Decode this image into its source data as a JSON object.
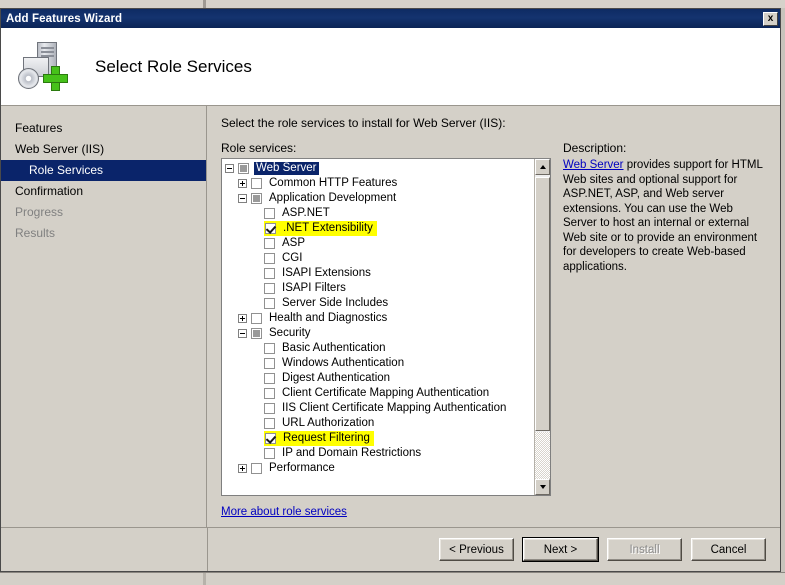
{
  "window": {
    "title": "Add Features Wizard",
    "close_label": "x",
    "header_title": "Select Role Services",
    "header_icon": "server-add-icon"
  },
  "sidebar": {
    "items": [
      {
        "label": "Features",
        "state": "normal",
        "indented": false
      },
      {
        "label": "Web Server (IIS)",
        "state": "normal",
        "indented": false
      },
      {
        "label": "Role Services",
        "state": "selected",
        "indented": true
      },
      {
        "label": "Confirmation",
        "state": "normal",
        "indented": false
      },
      {
        "label": "Progress",
        "state": "disabled",
        "indented": false
      },
      {
        "label": "Results",
        "state": "disabled",
        "indented": false
      }
    ]
  },
  "main": {
    "intro": "Select the role services to install for Web Server (IIS):",
    "tree_label": "Role services:",
    "description_label": "Description:",
    "more_link": "More about role services",
    "tree": [
      {
        "label": "Web Server",
        "depth": 0,
        "twist": "minus",
        "check": "partial",
        "selected": true,
        "highlight": false
      },
      {
        "label": "Common HTTP Features",
        "depth": 1,
        "twist": "plus",
        "check": "empty",
        "selected": false,
        "highlight": false
      },
      {
        "label": "Application Development",
        "depth": 1,
        "twist": "minus",
        "check": "partial",
        "selected": false,
        "highlight": false
      },
      {
        "label": "ASP.NET",
        "depth": 2,
        "twist": "none",
        "check": "empty",
        "selected": false,
        "highlight": false
      },
      {
        "label": ".NET Extensibility",
        "depth": 2,
        "twist": "none",
        "check": "checked",
        "selected": false,
        "highlight": true
      },
      {
        "label": "ASP",
        "depth": 2,
        "twist": "none",
        "check": "empty",
        "selected": false,
        "highlight": false
      },
      {
        "label": "CGI",
        "depth": 2,
        "twist": "none",
        "check": "empty",
        "selected": false,
        "highlight": false
      },
      {
        "label": "ISAPI Extensions",
        "depth": 2,
        "twist": "none",
        "check": "empty",
        "selected": false,
        "highlight": false
      },
      {
        "label": "ISAPI Filters",
        "depth": 2,
        "twist": "none",
        "check": "empty",
        "selected": false,
        "highlight": false
      },
      {
        "label": "Server Side Includes",
        "depth": 2,
        "twist": "none",
        "check": "empty",
        "selected": false,
        "highlight": false
      },
      {
        "label": "Health and Diagnostics",
        "depth": 1,
        "twist": "plus",
        "check": "empty",
        "selected": false,
        "highlight": false
      },
      {
        "label": "Security",
        "depth": 1,
        "twist": "minus",
        "check": "partial",
        "selected": false,
        "highlight": false
      },
      {
        "label": "Basic Authentication",
        "depth": 2,
        "twist": "none",
        "check": "empty",
        "selected": false,
        "highlight": false
      },
      {
        "label": "Windows Authentication",
        "depth": 2,
        "twist": "none",
        "check": "empty",
        "selected": false,
        "highlight": false
      },
      {
        "label": "Digest Authentication",
        "depth": 2,
        "twist": "none",
        "check": "empty",
        "selected": false,
        "highlight": false
      },
      {
        "label": "Client Certificate Mapping Authentication",
        "depth": 2,
        "twist": "none",
        "check": "empty",
        "selected": false,
        "highlight": false
      },
      {
        "label": "IIS Client Certificate Mapping Authentication",
        "depth": 2,
        "twist": "none",
        "check": "empty",
        "selected": false,
        "highlight": false
      },
      {
        "label": "URL Authorization",
        "depth": 2,
        "twist": "none",
        "check": "empty",
        "selected": false,
        "highlight": false
      },
      {
        "label": "Request Filtering",
        "depth": 2,
        "twist": "none",
        "check": "checked",
        "selected": false,
        "highlight": true
      },
      {
        "label": "IP and Domain Restrictions",
        "depth": 2,
        "twist": "none",
        "check": "empty",
        "selected": false,
        "highlight": false
      },
      {
        "label": "Performance",
        "depth": 1,
        "twist": "plus",
        "check": "empty",
        "selected": false,
        "highlight": false
      }
    ],
    "description": {
      "link_text": "Web Server",
      "body": " provides support for HTML Web sites and optional support for ASP.NET, ASP, and Web server extensions. You can use the Web Server to host an internal or external Web site or to provide an environment for developers to create Web-based applications."
    }
  },
  "footer": {
    "buttons": [
      {
        "label": "< Previous",
        "state": "normal",
        "name": "previous-button"
      },
      {
        "label": "Next >",
        "state": "default",
        "name": "next-button"
      },
      {
        "label": "Install",
        "state": "disabled",
        "name": "install-button"
      },
      {
        "label": "Cancel",
        "state": "normal",
        "name": "cancel-button"
      }
    ]
  },
  "colors": {
    "titlebar": "#0e2b63",
    "selection": "#0a246a",
    "highlight": "#ffff00",
    "dialog_face": "#d4d0c8",
    "link": "#0000c0"
  }
}
